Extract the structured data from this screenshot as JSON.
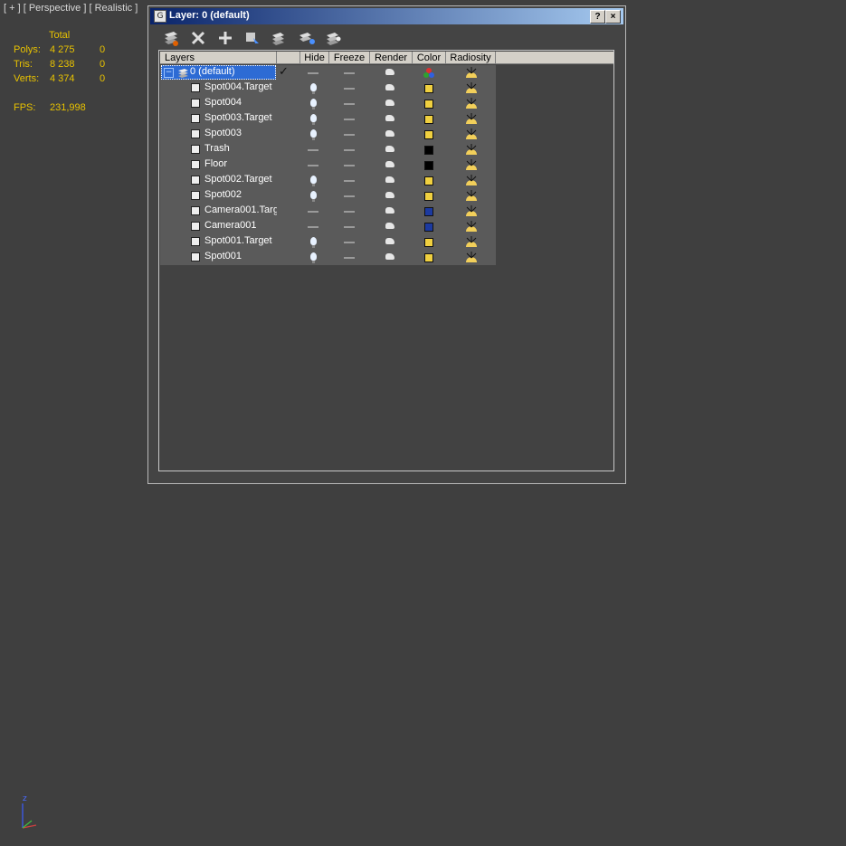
{
  "viewport": {
    "label": "[ + ] [ Perspective ] [ Realistic ]",
    "stats": {
      "header": "Total",
      "rows": [
        {
          "label": "Polys:",
          "total": "4 275",
          "sel": "0"
        },
        {
          "label": "Tris:",
          "total": "8 238",
          "sel": "0"
        },
        {
          "label": "Verts:",
          "total": "4 374",
          "sel": "0"
        }
      ],
      "fps_label": "FPS:",
      "fps_value": "231,998"
    },
    "colors": {
      "stats": "#e8c200",
      "background": "#3f3f3f"
    }
  },
  "dialog": {
    "title": "Layer: 0 (default)",
    "help_label": "?",
    "close_label": "×",
    "toolbar": [
      "new-layer-icon",
      "delete-layer-icon",
      "add-to-layer-icon",
      "select-objects-icon",
      "select-layer-icon",
      "make-current-icon",
      "hide-all-icon"
    ],
    "columns": [
      "Layers",
      "",
      "Hide",
      "Freeze",
      "Render",
      "Color",
      "Radiosity"
    ],
    "layer": {
      "name": "0 (default)",
      "expand": "−",
      "current_mark": "✓"
    },
    "objects": [
      {
        "name": "Spot004.Target",
        "hide": "bulb",
        "color": "#f0d040"
      },
      {
        "name": "Spot004",
        "hide": "bulb",
        "color": "#f0d040"
      },
      {
        "name": "Spot003.Target",
        "hide": "bulb",
        "color": "#f0d040"
      },
      {
        "name": "Spot003",
        "hide": "bulb",
        "color": "#f0d040"
      },
      {
        "name": "Trash",
        "hide": "dash",
        "color": "#000000"
      },
      {
        "name": "Floor",
        "hide": "dash",
        "color": "#000000"
      },
      {
        "name": "Spot002.Target",
        "hide": "bulb",
        "color": "#f0d040"
      },
      {
        "name": "Spot002",
        "hide": "bulb",
        "color": "#f0d040"
      },
      {
        "name": "Camera001.Targ",
        "hide": "dash",
        "color": "#1c3aa0"
      },
      {
        "name": "Camera001",
        "hide": "dash",
        "color": "#1c3aa0"
      },
      {
        "name": "Spot001.Target",
        "hide": "bulb",
        "color": "#f0d040"
      },
      {
        "name": "Spot001",
        "hide": "bulb",
        "color": "#f0d040"
      }
    ]
  },
  "axis": {
    "label": "z"
  }
}
